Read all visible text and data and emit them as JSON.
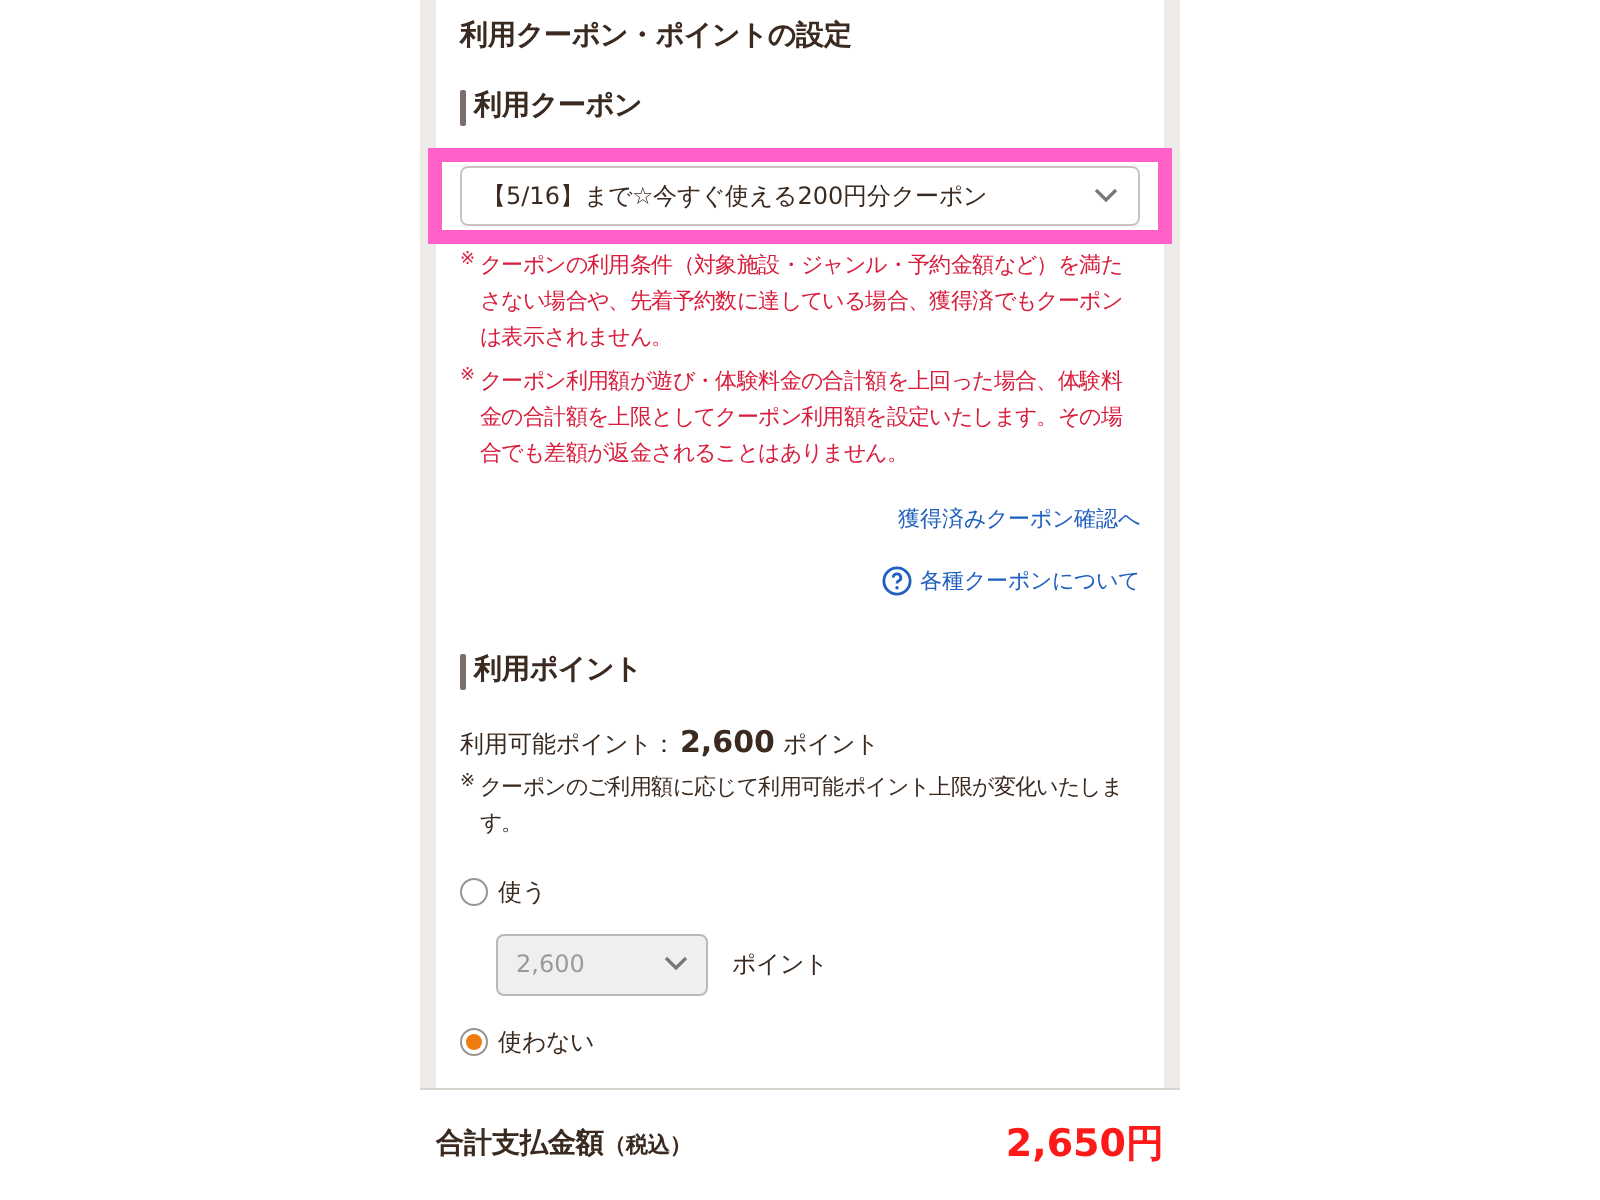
{
  "title": "利用クーポン・ポイントの設定",
  "coupon": {
    "heading": "利用クーポン",
    "select_value": "【5/16】まで☆今すぐ使える200円分クーポン",
    "highlighted": true,
    "notes": [
      {
        "mark": "※",
        "text": "クーポンの利用条件（対象施設・ジャンル・予約金額など）を満たさない場合や、先着予約数に達している場合、獲得済でもクーポンは表示されません。"
      },
      {
        "mark": "※",
        "text": "クーポン利用額が遊び・体験料金の合計額を上回った場合、体験料金の合計額を上限としてクーポン利用額を設定いたします。その場合でも差額が返金されることはありません。"
      }
    ],
    "links": [
      {
        "kind": "plain",
        "label": "獲得済みクーポン確認へ"
      },
      {
        "kind": "help",
        "label": "各種クーポンについて"
      }
    ]
  },
  "points": {
    "heading": "利用ポイント",
    "available_label": "利用可能ポイント：",
    "available_value": "2,600",
    "available_unit": "ポイント",
    "note": {
      "mark": "※",
      "text": "クーポンのご利用額に応じて利用可能ポイント上限が変化いたします。"
    },
    "options": [
      {
        "label": "使う",
        "selected": false
      },
      {
        "label": "使わない",
        "selected": true
      }
    ],
    "amount_select": {
      "value": "2,600",
      "unit": "ポイント",
      "disabled": true
    }
  },
  "total": {
    "label": "合計支払金額",
    "label_suffix": "（税込）",
    "value": "2,650円"
  }
}
